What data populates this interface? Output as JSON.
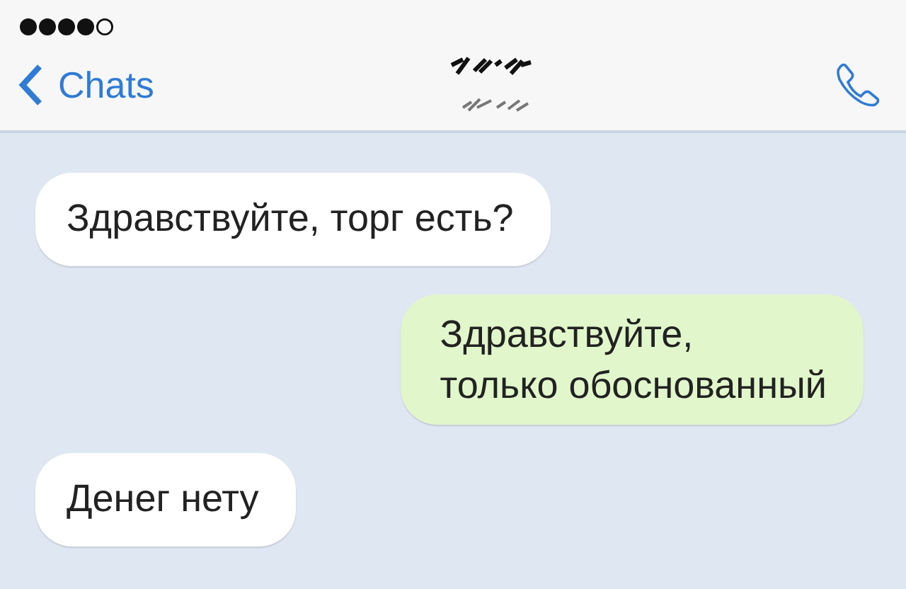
{
  "header": {
    "back_label": "Chats"
  },
  "messages": [
    {
      "kind": "incoming",
      "text": "Здравствуйте, торг есть?"
    },
    {
      "kind": "outgoing",
      "text": "Здравствуйте,\nтолько обоснованный"
    },
    {
      "kind": "incoming",
      "text": "Денег нету"
    }
  ]
}
